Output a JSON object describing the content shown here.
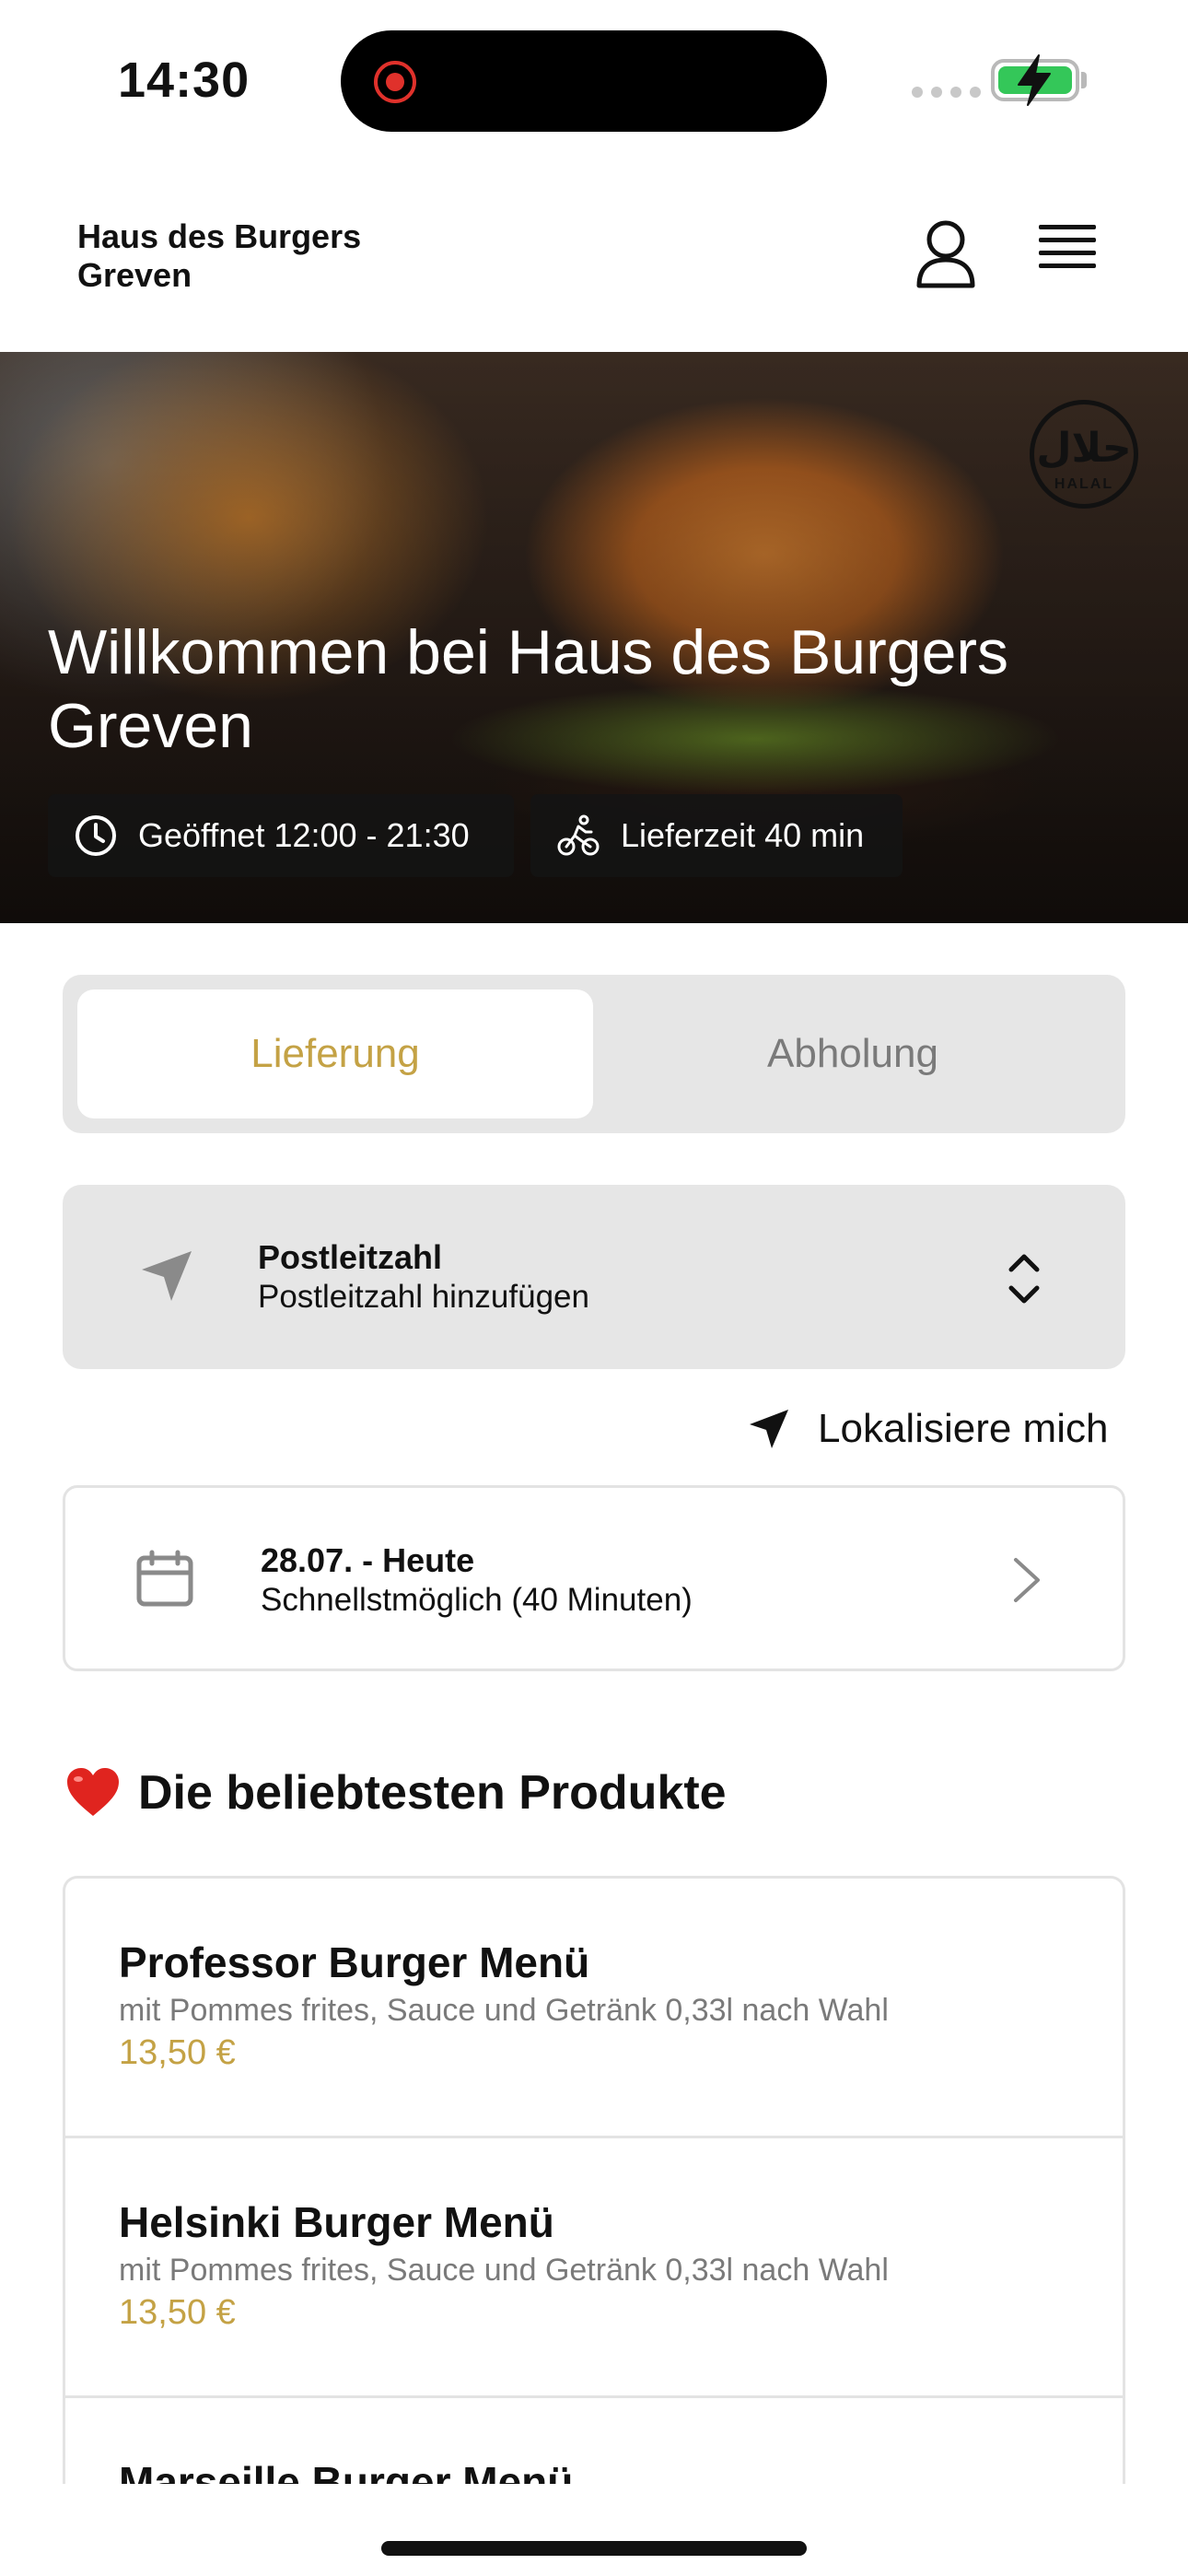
{
  "status_bar": {
    "time": "14:30"
  },
  "header": {
    "restaurant_name": "Haus des Burgers Greven",
    "icons": [
      "user-icon",
      "hamburger-menu-icon"
    ]
  },
  "hero": {
    "title": "Willkommen bei Haus des Burgers Greven",
    "badge_arabic": "حلال",
    "badge_latin": "HALAL",
    "opening_hours": "Geöffnet 12:00 - 21:30",
    "delivery_time": "Lieferzeit 40 min"
  },
  "order_mode": {
    "tabs": [
      {
        "label": "Lieferung",
        "active": true
      },
      {
        "label": "Abholung",
        "active": false
      }
    ]
  },
  "postcode": {
    "label": "Postleitzahl",
    "value": "Postleitzahl hinzufügen"
  },
  "locate": {
    "label": "Lokalisiere mich"
  },
  "schedule": {
    "date": "28.07. - Heute",
    "time": "Schnellstmöglich (40 Minuten)"
  },
  "popular": {
    "title": "Die beliebtesten Produkte",
    "products": [
      {
        "name": "Professor Burger Menü",
        "description": "mit Pommes frites, Sauce und Getränk 0,33l nach Wahl",
        "price": "13,50 €"
      },
      {
        "name": "Helsinki Burger Menü",
        "description": "mit Pommes frites, Sauce und Getränk 0,33l nach Wahl",
        "price": "13,50 €"
      },
      {
        "name": "Marseille Burger Menü",
        "description": "",
        "price": ""
      }
    ]
  },
  "colors": {
    "accent": "#c4a245",
    "panel": "#e6e6e6",
    "border": "#e3e3e3",
    "muted_text": "#7a7a7a"
  }
}
